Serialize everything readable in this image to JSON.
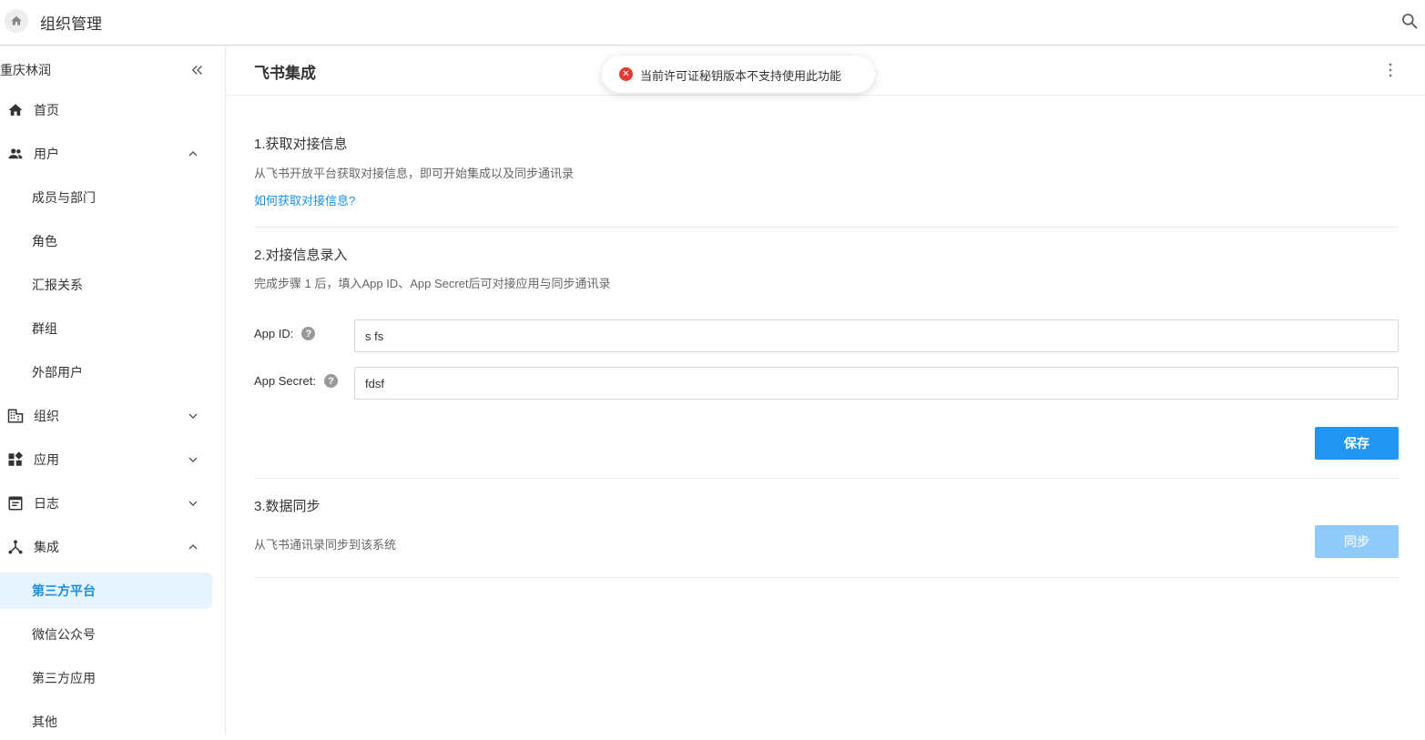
{
  "topbar": {
    "title": "组织管理",
    "home_icon": "home-icon",
    "search_icon": "search-icon"
  },
  "sidebar": {
    "org_name": "重庆林润",
    "collapse_icon": "double-chevron-left-icon",
    "items": [
      {
        "label": "首页",
        "icon": "home-icon"
      },
      {
        "label": "用户",
        "icon": "users-icon",
        "expanded": true
      },
      {
        "label": "成员与部门"
      },
      {
        "label": "角色"
      },
      {
        "label": "汇报关系"
      },
      {
        "label": "群组"
      },
      {
        "label": "外部用户"
      },
      {
        "label": "组织",
        "icon": "building-icon",
        "expanded": false
      },
      {
        "label": "应用",
        "icon": "apps-icon",
        "expanded": false
      },
      {
        "label": "日志",
        "icon": "log-icon",
        "expanded": false
      },
      {
        "label": "集成",
        "icon": "integration-icon",
        "expanded": true
      },
      {
        "label": "第三方平台",
        "active": true
      },
      {
        "label": "微信公众号"
      },
      {
        "label": "第三方应用"
      },
      {
        "label": "其他"
      }
    ]
  },
  "main": {
    "title": "飞书集成",
    "more_icon": "more-vertical-icon",
    "section1": {
      "title": "1.获取对接信息",
      "desc": "从飞书开放平台获取对接信息，即可开始集成以及同步通讯录",
      "link": "如何获取对接信息?"
    },
    "section2": {
      "title": "2.对接信息录入",
      "desc": "完成步骤 1 后，填入App ID、App Secret后可对接应用与同步通讯录",
      "app_id_label": "App ID:",
      "app_id_value": "s fs",
      "app_secret_label": "App Secret:",
      "app_secret_value": "fdsf",
      "save_label": "保存"
    },
    "section3": {
      "title": "3.数据同步",
      "desc": "从飞书通讯录同步到该系统",
      "sync_label": "同步"
    }
  },
  "toast": {
    "message": "当前许可证秘钥版本不支持使用此功能",
    "icon": "error-circle-icon"
  },
  "colors": {
    "accent": "#2196f3",
    "link": "#1a8fe6",
    "error": "#e53935",
    "active_bg": "#e8f4fd"
  }
}
